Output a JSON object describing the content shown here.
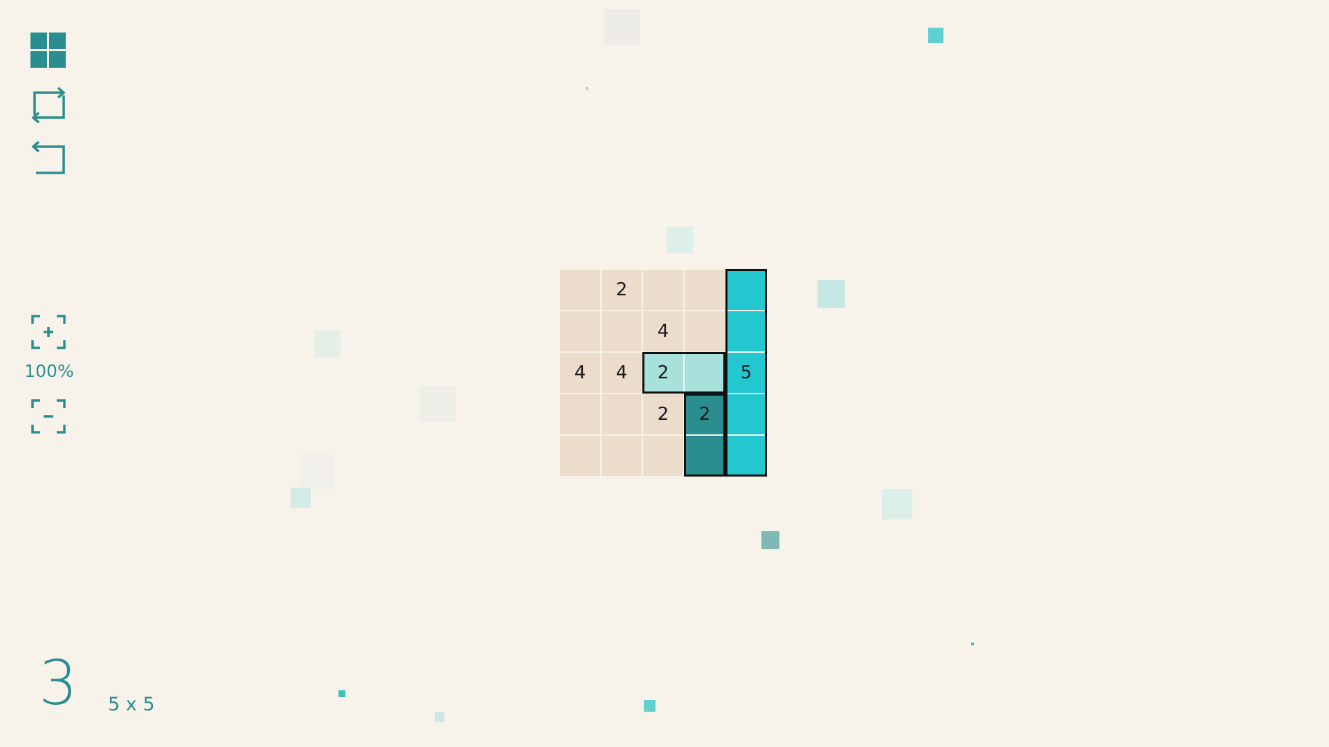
{
  "toolbar": {
    "levels_icon": "grid-icon",
    "restart_icon": "restart-icon",
    "undo_icon": "undo-icon"
  },
  "zoom": {
    "zoom_in_icon": "zoom-in-icon",
    "level": "100%",
    "zoom_out_icon": "zoom-out-icon"
  },
  "level": {
    "number": "3",
    "size": "5 x 5"
  },
  "colors": {
    "background": "#f7f3ea",
    "empty_cell": "#ebdccb",
    "accent": "#2a8e8e",
    "piece_light": "#a8e0dc",
    "piece_dark": "#2a8e8e",
    "piece_bright": "#22c7cf"
  },
  "board": {
    "rows": 5,
    "cols": 5,
    "cells": [
      [
        {
          "label": "",
          "fill": "empty"
        },
        {
          "label": "2",
          "fill": "empty"
        },
        {
          "label": "",
          "fill": "empty"
        },
        {
          "label": "",
          "fill": "empty"
        },
        {
          "label": "",
          "fill": "bright"
        }
      ],
      [
        {
          "label": "",
          "fill": "empty"
        },
        {
          "label": "",
          "fill": "empty"
        },
        {
          "label": "4",
          "fill": "empty"
        },
        {
          "label": "",
          "fill": "empty"
        },
        {
          "label": "",
          "fill": "bright"
        }
      ],
      [
        {
          "label": "4",
          "fill": "empty"
        },
        {
          "label": "4",
          "fill": "empty"
        },
        {
          "label": "2",
          "fill": "light"
        },
        {
          "label": "",
          "fill": "light"
        },
        {
          "label": "5",
          "fill": "bright"
        }
      ],
      [
        {
          "label": "",
          "fill": "empty"
        },
        {
          "label": "",
          "fill": "empty"
        },
        {
          "label": "2",
          "fill": "empty"
        },
        {
          "label": "2",
          "fill": "dark"
        },
        {
          "label": "",
          "fill": "bright"
        }
      ],
      [
        {
          "label": "",
          "fill": "empty"
        },
        {
          "label": "",
          "fill": "empty"
        },
        {
          "label": "",
          "fill": "empty"
        },
        {
          "label": "",
          "fill": "dark"
        },
        {
          "label": "",
          "fill": "bright"
        }
      ]
    ]
  }
}
